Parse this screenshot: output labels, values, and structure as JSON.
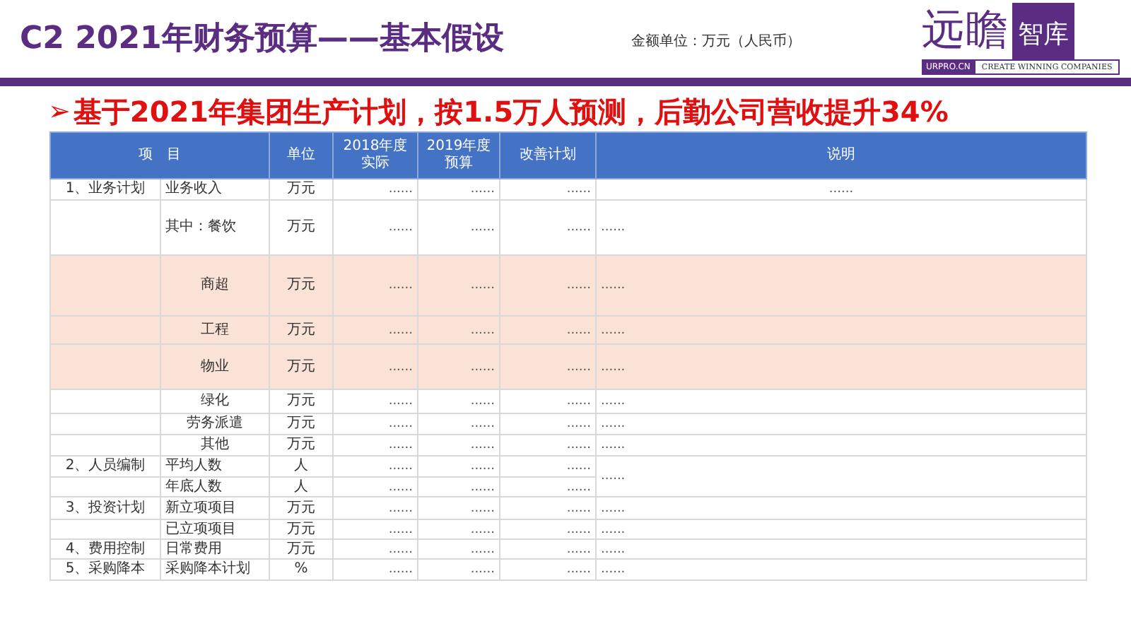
{
  "header": {
    "title": "C2  2021年财务预算——基本假设",
    "unit_note": "金额单位：万元（人民币）",
    "logo": {
      "calligraphy": "远瞻",
      "badge": "智库",
      "site": "URPRO.CN",
      "slogan": "CREATE WINNING COMPANIES"
    }
  },
  "headline": {
    "marker": "➢",
    "text": "基于2021年集团生产计划，按1.5万人预测，后勤公司营收提升34%"
  },
  "table": {
    "columns": [
      "项　目",
      "单位",
      "2018年度实际",
      "2019年度预算",
      "改善计划",
      "说明"
    ],
    "rows": [
      {
        "category": "1、业务计划",
        "item": "业务收入",
        "kind": "main",
        "unit": "万元",
        "actual_2018": "......",
        "budget_2019": "......",
        "plan": "......",
        "note": "......",
        "highlighted": false
      },
      {
        "item": "其中：餐饮",
        "kind": "main",
        "unit": "万元",
        "actual_2018": "......",
        "budget_2019": "......",
        "plan": "......",
        "note": "......",
        "highlighted": false
      },
      {
        "item": "商超",
        "kind": "sub",
        "unit": "万元",
        "actual_2018": "......",
        "budget_2019": "......",
        "plan": "......",
        "note": "......",
        "highlighted": true
      },
      {
        "item": "工程",
        "kind": "sub",
        "unit": "万元",
        "actual_2018": "......",
        "budget_2019": "......",
        "plan": "......",
        "note": "......",
        "highlighted": true
      },
      {
        "item": "物业",
        "kind": "sub",
        "unit": "万元",
        "actual_2018": "......",
        "budget_2019": "......",
        "plan": "......",
        "note": "......",
        "highlighted": true
      },
      {
        "item": "绿化",
        "kind": "sub",
        "unit": "万元",
        "actual_2018": "......",
        "budget_2019": "......",
        "plan": "......",
        "note": "......",
        "highlighted": false
      },
      {
        "item": "劳务派遣",
        "kind": "sub",
        "unit": "万元",
        "actual_2018": "......",
        "budget_2019": "......",
        "plan": "......",
        "note": "......",
        "highlighted": false
      },
      {
        "item": "其他",
        "kind": "sub",
        "unit": "万元",
        "actual_2018": "......",
        "budget_2019": "......",
        "plan": "......",
        "note": "......",
        "highlighted": false
      },
      {
        "category": "2、人员编制",
        "item": "平均人数",
        "kind": "main",
        "unit": "人",
        "actual_2018": "......",
        "budget_2019": "......",
        "plan": "......",
        "note": "......",
        "highlighted": false
      },
      {
        "item": "年底人数",
        "kind": "main",
        "unit": "人",
        "actual_2018": "......",
        "budget_2019": "......",
        "plan": "......",
        "highlighted": false
      },
      {
        "category": "3、投资计划",
        "item": "新立项项目",
        "kind": "main",
        "unit": "万元",
        "actual_2018": "......",
        "budget_2019": "......",
        "plan": "......",
        "note": "......",
        "highlighted": false
      },
      {
        "item": "已立项项目",
        "kind": "main",
        "unit": "万元",
        "actual_2018": "......",
        "budget_2019": "......",
        "plan": "......",
        "note": "......",
        "highlighted": false
      },
      {
        "category": "4、费用控制",
        "item": "日常费用",
        "kind": "main",
        "unit": "万元",
        "actual_2018": "......",
        "budget_2019": "......",
        "plan": "......",
        "note": "......",
        "highlighted": false
      },
      {
        "category": "5、采购降本",
        "item": "采购降本计划",
        "kind": "main",
        "unit": "%",
        "actual_2018": "......",
        "budget_2019": "......",
        "plan": "......",
        "note": "......",
        "highlighted": false
      }
    ]
  }
}
